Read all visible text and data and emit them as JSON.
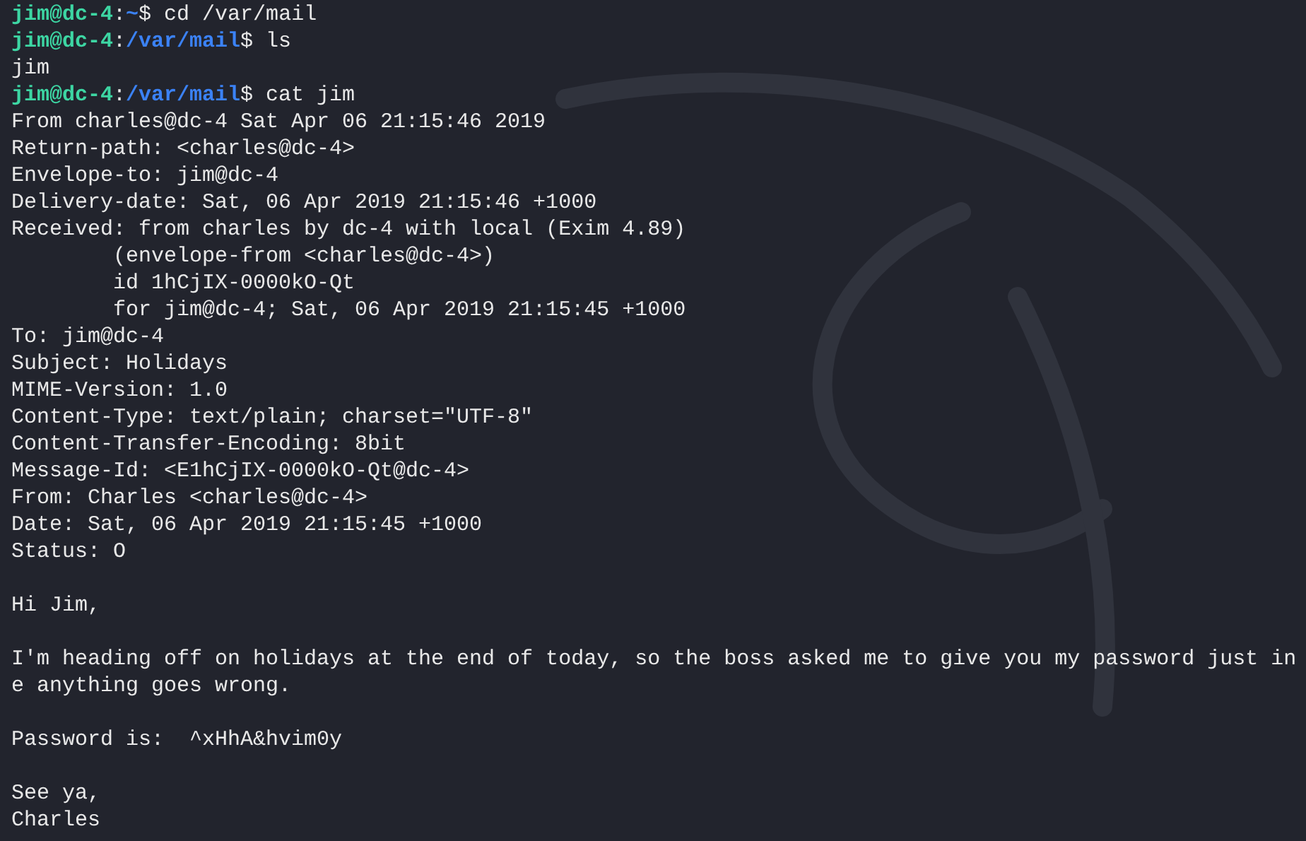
{
  "terminal": {
    "lines": [
      {
        "kind": "prompt",
        "parts": [
          {
            "kind": "user",
            "text": "jim@dc-4"
          },
          {
            "kind": "plain",
            "text": ":"
          },
          {
            "kind": "path",
            "text": "~"
          },
          {
            "kind": "plain",
            "text": "$ cd /var/mail"
          }
        ]
      },
      {
        "kind": "prompt",
        "parts": [
          {
            "kind": "user",
            "text": "jim@dc-4"
          },
          {
            "kind": "plain",
            "text": ":"
          },
          {
            "kind": "path",
            "text": "/var/mail"
          },
          {
            "kind": "plain",
            "text": "$ ls"
          }
        ]
      },
      {
        "kind": "output",
        "text": "jim"
      },
      {
        "kind": "prompt",
        "parts": [
          {
            "kind": "user",
            "text": "jim@dc-4"
          },
          {
            "kind": "plain",
            "text": ":"
          },
          {
            "kind": "path",
            "text": "/var/mail"
          },
          {
            "kind": "plain",
            "text": "$ cat jim"
          }
        ]
      },
      {
        "kind": "output",
        "text": "From charles@dc-4 Sat Apr 06 21:15:46 2019"
      },
      {
        "kind": "output",
        "text": "Return-path: <charles@dc-4>"
      },
      {
        "kind": "output",
        "text": "Envelope-to: jim@dc-4"
      },
      {
        "kind": "output",
        "text": "Delivery-date: Sat, 06 Apr 2019 21:15:46 +1000"
      },
      {
        "kind": "output",
        "text": "Received: from charles by dc-4 with local (Exim 4.89)"
      },
      {
        "kind": "output",
        "text": "        (envelope-from <charles@dc-4>)"
      },
      {
        "kind": "output",
        "text": "        id 1hCjIX-0000kO-Qt"
      },
      {
        "kind": "output",
        "text": "        for jim@dc-4; Sat, 06 Apr 2019 21:15:45 +1000"
      },
      {
        "kind": "output",
        "text": "To: jim@dc-4"
      },
      {
        "kind": "output",
        "text": "Subject: Holidays"
      },
      {
        "kind": "output",
        "text": "MIME-Version: 1.0"
      },
      {
        "kind": "output",
        "text": "Content-Type: text/plain; charset=\"UTF-8\""
      },
      {
        "kind": "output",
        "text": "Content-Transfer-Encoding: 8bit"
      },
      {
        "kind": "output",
        "text": "Message-Id: <E1hCjIX-0000kO-Qt@dc-4>"
      },
      {
        "kind": "output",
        "text": "From: Charles <charles@dc-4>"
      },
      {
        "kind": "output",
        "text": "Date: Sat, 06 Apr 2019 21:15:45 +1000"
      },
      {
        "kind": "output",
        "text": "Status: O"
      },
      {
        "kind": "blank"
      },
      {
        "kind": "output",
        "text": "Hi Jim,"
      },
      {
        "kind": "blank"
      },
      {
        "kind": "output",
        "text": "I'm heading off on holidays at the end of today, so the boss asked me to give you my password just in"
      },
      {
        "kind": "output",
        "text": "e anything goes wrong."
      },
      {
        "kind": "blank"
      },
      {
        "kind": "output",
        "text": "Password is:  ^xHhA&hvim0y"
      },
      {
        "kind": "blank"
      },
      {
        "kind": "output",
        "text": "See ya,"
      },
      {
        "kind": "output",
        "text": "Charles"
      }
    ]
  }
}
